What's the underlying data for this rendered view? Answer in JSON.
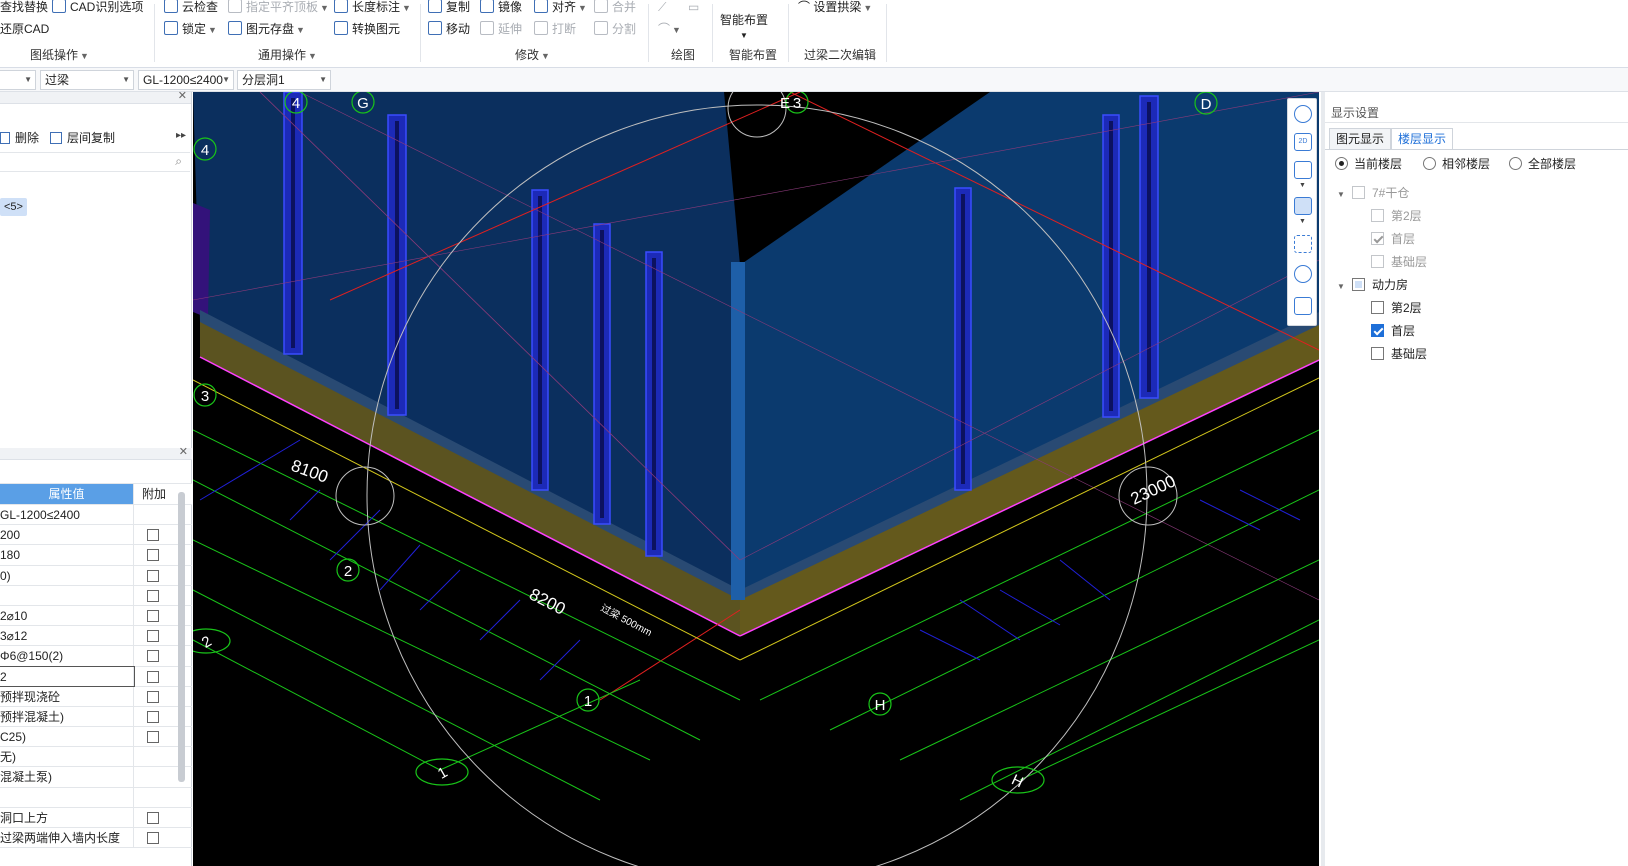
{
  "ribbon": {
    "g1": {
      "find_replace": "查找替换",
      "cad_options": "CAD识别选项",
      "restore_cad": "还原CAD",
      "label": "图纸操作"
    },
    "g2": {
      "cloud_check": "云检查",
      "flat_top": "指定平齐顶板",
      "length_dim": "长度标注",
      "lock": "锁定",
      "elem_save": "图元存盘",
      "convert": "转换图元",
      "label": "通用操作"
    },
    "g3": {
      "copy": "复制",
      "mirror": "镜像",
      "align": "对齐",
      "merge": "合并",
      "move": "移动",
      "extend": "延伸",
      "break": "打断",
      "split": "分割",
      "label": "修改"
    },
    "g4": {
      "label": "绘图"
    },
    "g5": {
      "smart": "智能布置",
      "label": "智能布置"
    },
    "g6": {
      "set_arch": "设置拱梁",
      "label": "过梁二次编辑"
    }
  },
  "selectors": {
    "s2": "过梁",
    "s3": "GL-1200≤2400",
    "s4": "分层洞1"
  },
  "left": {
    "delete": "删除",
    "floor_copy": "层间复制",
    "tree_badge": "<5>",
    "prop_header": "属性值",
    "attach_header": "附加",
    "props": [
      {
        "v": "GL-1200≤2400",
        "c": false
      },
      {
        "v": "200",
        "c": true
      },
      {
        "v": "180",
        "c": true
      },
      {
        "v": "0)",
        "c": true
      },
      {
        "v": "",
        "c": true
      },
      {
        "v": "2⌀10",
        "c": true
      },
      {
        "v": "3⌀12",
        "c": true
      },
      {
        "v": "Φ6@150(2)",
        "c": true
      },
      {
        "v": "2",
        "c": true
      },
      {
        "v": "预拌现浇砼",
        "c": true
      },
      {
        "v": "预拌混凝土)",
        "c": true
      },
      {
        "v": "C25)",
        "c": true
      },
      {
        "v": "无)",
        "c": false
      },
      {
        "v": "混凝土泵)",
        "c": false
      },
      {
        "v": "",
        "c": false
      },
      {
        "v": "洞口上方",
        "c": true
      },
      {
        "v": "过梁两端伸入墙内长度",
        "c": true
      }
    ]
  },
  "viewport": {
    "axes": [
      "4",
      "G",
      "E",
      "3",
      "D",
      "4",
      "3",
      "2",
      "1",
      "H",
      "2",
      "1",
      "H"
    ],
    "dims": {
      "big1": "8100",
      "big2": "8200",
      "big3": "23000",
      "beam_mark": "过梁 500mm"
    },
    "colors": {
      "wall": "#0b2f5e",
      "slab": "#615a1c",
      "column": "#1c2ab8",
      "grid_green": "#19c419",
      "axis_red": "#e02020"
    }
  },
  "right": {
    "title": "显示设置",
    "tab1": "图元显示",
    "tab2": "楼层显示",
    "radio1": "当前楼层",
    "radio2": "相邻楼层",
    "radio3": "全部楼层",
    "groupA": "7#干仓",
    "groupA_items": [
      "第2层",
      "首层",
      "基础层"
    ],
    "groupB": "动力房",
    "groupB_items": [
      "第2层",
      "首层",
      "基础层"
    ]
  }
}
